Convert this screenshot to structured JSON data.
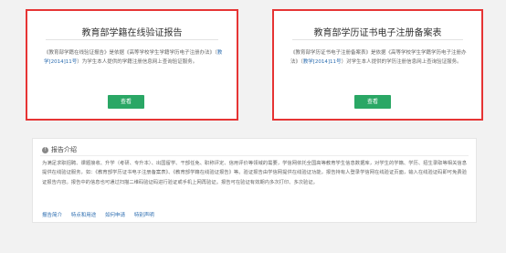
{
  "cards": [
    {
      "title": "教育部学籍在线验证报告",
      "desc_pre": "《教育部学籍在线验证报告》是依据《高等学校学生学籍学历电子注册办法》（",
      "desc_link": "教学[2014]11号",
      "desc_post": "）为学生本人提供的学籍注册信息网上查询验证服务。",
      "button": "查看"
    },
    {
      "title": "教育部学历证书电子注册备案表",
      "desc_pre": "《教育部学历证书电子注册备案表》是依据《高等学校学生学籍学历电子注册办法》（",
      "desc_link": "教学[2014]11号",
      "desc_post": "）对学生本人提供的学历注册信息网上查询验证服务。",
      "button": "查看"
    }
  ],
  "intro": {
    "heading": "报告介绍",
    "body": "为满足求职招聘、课题接收、升学（考研、专升本）、出国留学、干部任免、职称评定、信用评价等领域的需要，学信网依托全国高等教育学生信息数据库，对学生的学籍、学历、招生录取等相关信息提供在线验证服务，如：《教育部学历证书电子注册备案表》、《教育部学籍在线验证报告》等。验证报告由学信网提供在线验证功能，报告持有人登录学信网在线验证页面，输入在线验证码即可免费验证报告内容。报告中的信息也可通过扫描二维码验证码进行验证或手机上网再验证。报告可在验证有效期内多次打印、多次验证。",
    "links": [
      "报告简介",
      "特点和用途",
      "如何申请",
      "特别声明"
    ]
  }
}
